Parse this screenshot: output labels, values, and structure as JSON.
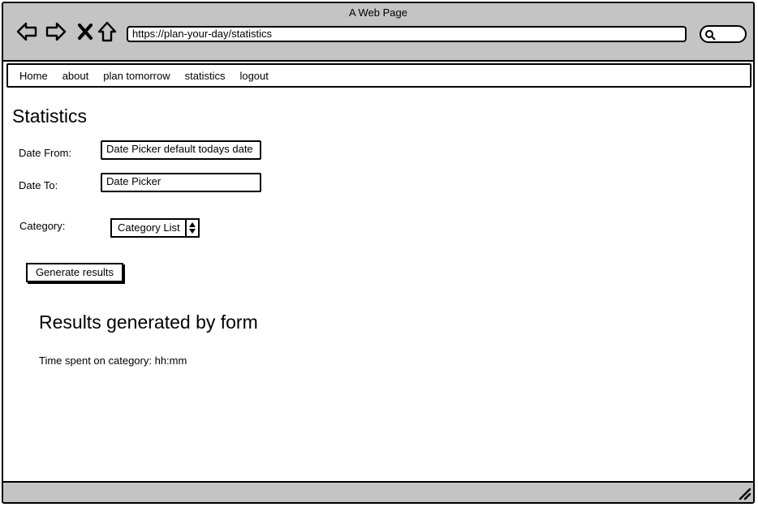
{
  "window": {
    "title": "A Web Page"
  },
  "browser": {
    "url": "https://plan-your-day/statistics",
    "icons": [
      "back-arrow-icon",
      "forward-arrow-icon",
      "close-x-icon",
      "home-icon",
      "search-icon"
    ]
  },
  "menu": {
    "items": [
      {
        "label": "Home"
      },
      {
        "label": "about"
      },
      {
        "label": "plan tomorrow"
      },
      {
        "label": "statistics"
      },
      {
        "label": "logout"
      }
    ]
  },
  "page": {
    "title": "Statistics",
    "form": {
      "date_from_label": "Date From:",
      "date_from_value": "Date Picker default todays date",
      "date_to_label": "Date To:",
      "date_to_value": "Date Picker",
      "category_label": "Category:",
      "category_value": "Category List",
      "submit_label": "Generate results"
    },
    "results": {
      "title": "Results generated by form",
      "text": "Time spent on category: hh:mm"
    }
  }
}
